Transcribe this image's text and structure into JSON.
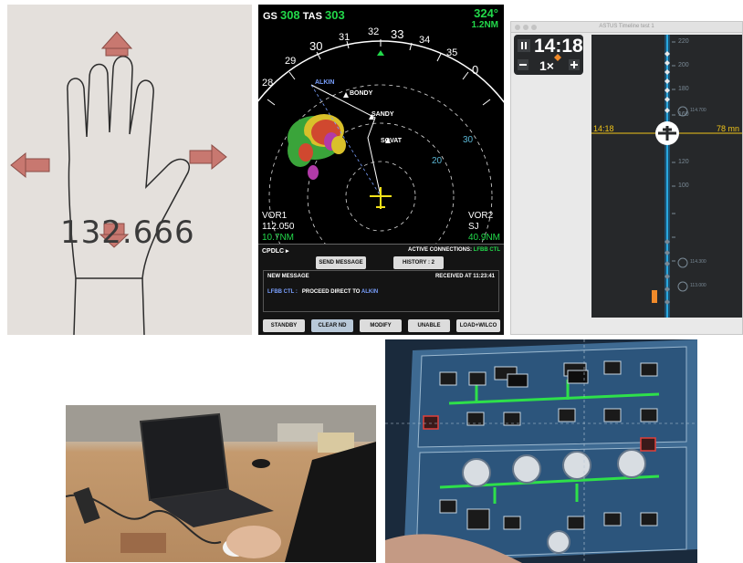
{
  "hand": {
    "written_number": "132.666"
  },
  "nd": {
    "gs_label": "GS",
    "gs_value": "308",
    "tas_label": "TAS",
    "tas_value": "303",
    "heading_top": "324°",
    "dist_top": "1.2NM",
    "compass": [
      "28",
      "29",
      "30",
      "31",
      "32",
      "33",
      "34",
      "35",
      "0"
    ],
    "waypoints": [
      "ALKIN",
      "BONDY",
      "SANDY",
      "SOVAT"
    ],
    "ranges": [
      "30",
      "20"
    ],
    "vor1": {
      "label": "VOR1",
      "freq": "112.050",
      "dist": "10.7NM"
    },
    "vor2": {
      "label": "VOR2",
      "ident": "SJ",
      "dist": "40.9NM"
    }
  },
  "cpdlc": {
    "title": "CPDLC ▸",
    "active_label": "ACTIVE CONNECTIONS:",
    "active_value": "LFBB CTL",
    "send_button": "SEND MESSAGE",
    "history_button": "HISTORY : 2",
    "new_message": "NEW MESSAGE",
    "received": "RECEIVED AT 11:23:41",
    "sender": "LFBB CTL :",
    "message": "PROCEED DIRECT TO",
    "message_target": "ALKIN",
    "actions": [
      "STANDBY",
      "CLEAR ND",
      "MODIFY",
      "UNABLE",
      "LOAD+WILCO"
    ]
  },
  "timeline": {
    "window_title": "ASTUS Timeline test 1",
    "time": "14:18",
    "rate": "1×",
    "now_label": "14:18",
    "eta": "78 mn",
    "ticks": [
      "220",
      "200",
      "180",
      "160",
      "120",
      "100"
    ],
    "freqs": [
      "114.700",
      "114.300",
      "113.000"
    ]
  },
  "colors": {
    "nd_green": "#22d84a",
    "nd_cyan": "#5ab6d4",
    "nd_yellow": "#f3e21a",
    "timeline_yellow": "#f0c419",
    "timeline_blue": "#29a9e0"
  }
}
